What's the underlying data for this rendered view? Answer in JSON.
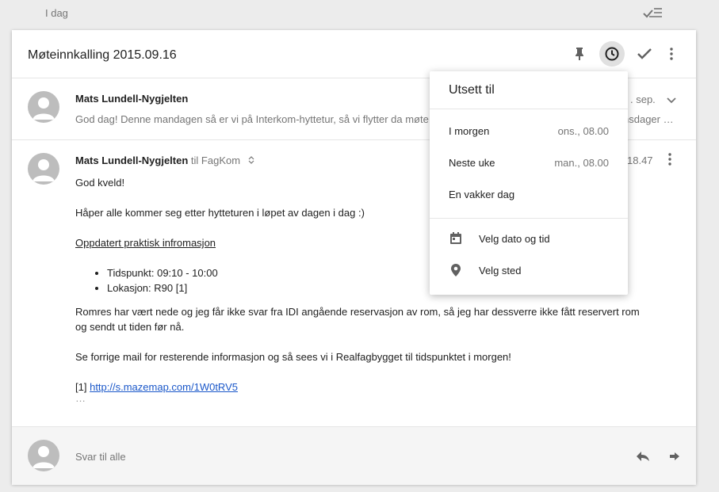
{
  "top": {
    "date_label": "I dag"
  },
  "thread": {
    "subject": "Møteinnkalling 2015.09.16",
    "messages": [
      {
        "sender": "Mats Lundell-Nygjelten",
        "date": ". sep.",
        "snippet": "God dag! Denne mandagen så er vi på Interkom-hyttetur, så vi flytter da møte",
        "snippet_tail": "nsdager …"
      },
      {
        "sender": "Mats Lundell-Nygjelten",
        "to_text": "til FagKom",
        "time": "18.47",
        "greeting": "God kveld!",
        "para1": "Håper alle kommer seg etter hytteturen i løpet av dagen i dag :)",
        "heading": "Oppdatert praktisk infromasjon",
        "bullets": [
          "Tidspunkt: 09:10 - 10:00",
          "Lokasjon: R90 [1]"
        ],
        "para2": "Romres har vært nede og jeg får ikke svar fra IDI angående reservasjon av rom, så jeg har dessverre ikke fått reservert rom og sendt ut tiden før nå.",
        "para3": "Se forrige mail for resterende informasjon og så sees vi i Realfagbygget til tidspunktet i morgen!",
        "ref_prefix": "[1]",
        "link": "http://s.mazemap.com/1W0tRV5",
        "trimmed": "…"
      }
    ]
  },
  "reply": {
    "placeholder": "Svar til alle"
  },
  "snooze": {
    "title": "Utsett til",
    "options": [
      {
        "label": "I morgen",
        "value": "ons., 08.00"
      },
      {
        "label": "Neste uke",
        "value": "man., 08.00"
      },
      {
        "label": "En vakker dag",
        "value": ""
      }
    ],
    "custom": [
      {
        "label": "Velg dato og tid",
        "icon": "calendar-icon"
      },
      {
        "label": "Velg sted",
        "icon": "location-pin-icon"
      }
    ]
  },
  "colors": {
    "accent_link": "#1a57c9",
    "muted": "#757575",
    "avatar": "#bdbdbd"
  }
}
